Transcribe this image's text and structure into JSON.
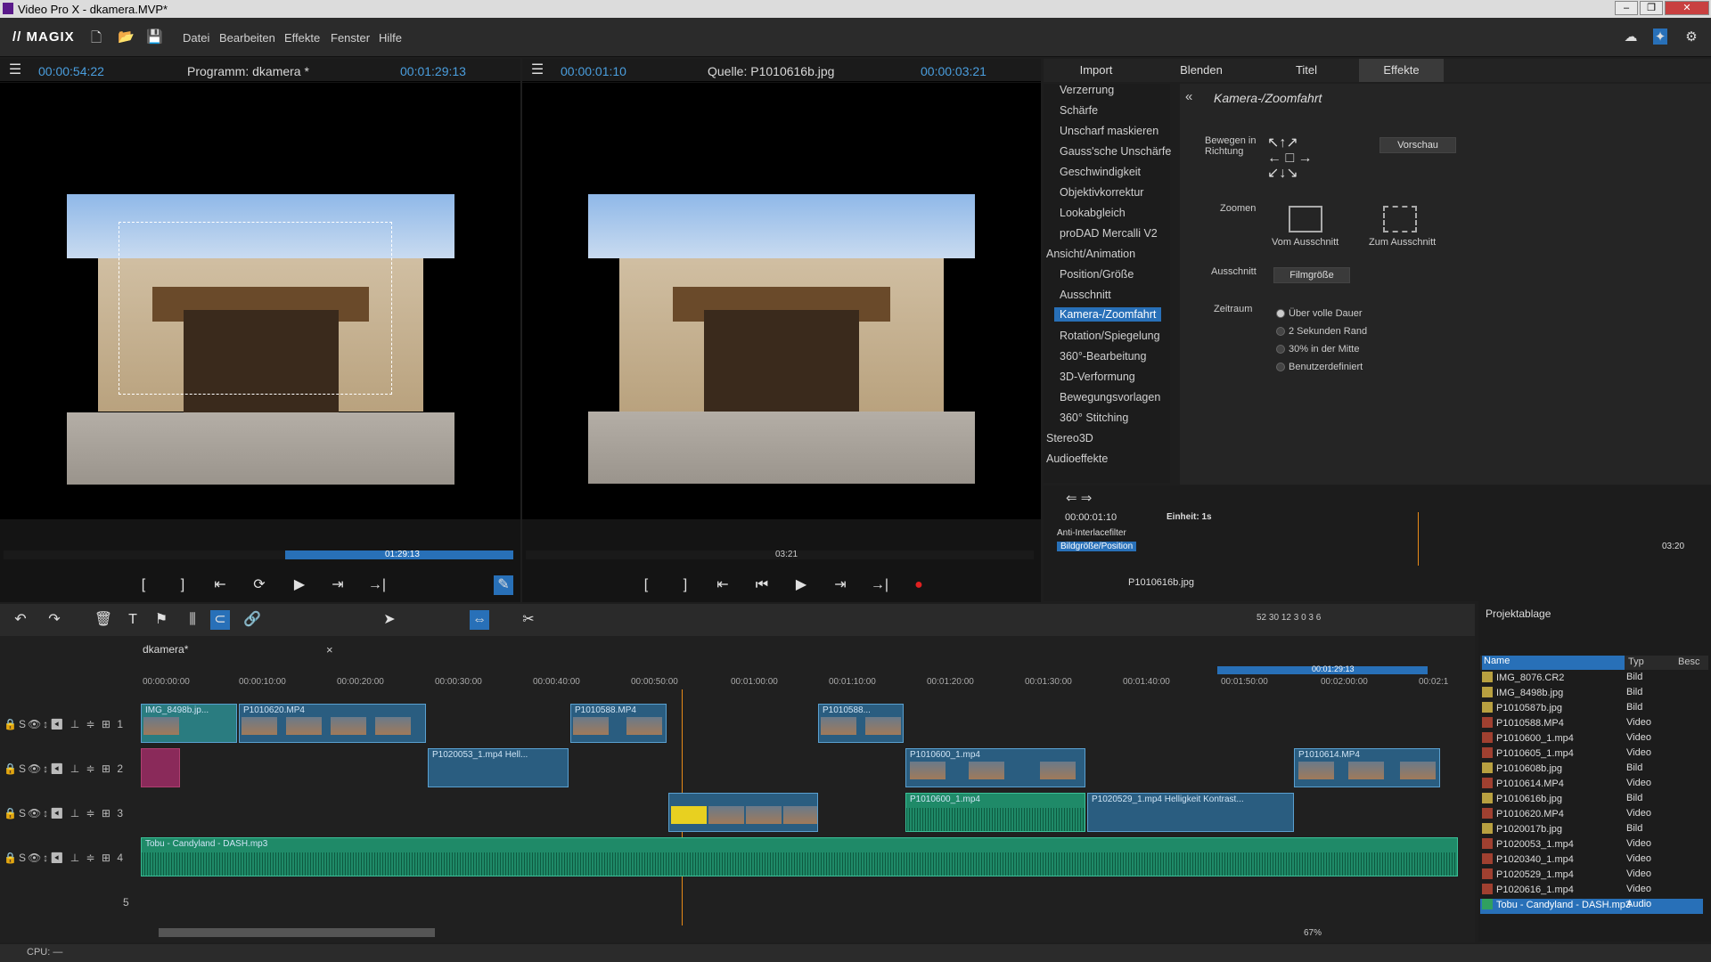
{
  "window": {
    "title": "Video Pro X - dkamera.MVP*"
  },
  "menubar": {
    "logo": "// MAGIX",
    "items": [
      "Datei",
      "Bearbeiten",
      "Effekte",
      "Fenster",
      "Hilfe"
    ]
  },
  "program_monitor": {
    "timecode_left": "00:00:54:22",
    "title": "Programm: dkamera *",
    "timecode_right": "00:01:29:13",
    "scrub_label": "01:29:13"
  },
  "source_monitor": {
    "timecode_left": "00:00:01:10",
    "title": "Quelle: P1010616b.jpg",
    "timecode_right": "00:00:03:21",
    "scrub_label": "03:21"
  },
  "tabs": [
    "Import",
    "Blenden",
    "Titel",
    "Effekte"
  ],
  "effects_list": [
    "Verzerrung",
    "Schärfe",
    "Unscharf maskieren",
    "Gauss'sche Unschärfe",
    "Geschwindigkeit",
    "Objektivkorrektur",
    "Lookabgleich",
    "proDAD Mercalli V2",
    "Ansicht/Animation",
    "Position/Größe",
    "Ausschnitt",
    "Kamera-/Zoomfahrt",
    "Rotation/Spiegelung",
    "360°-Bearbeitung",
    "3D-Verformung",
    "Bewegungsvorlagen",
    "360° Stitching",
    "Stereo3D",
    "Audioeffekte"
  ],
  "effect_panel": {
    "title": "Kamera-/Zoomfahrt",
    "move_label": "Bewegen in Richtung",
    "preview": "Vorschau",
    "zoom_label": "Zoomen",
    "zoom_from": "Vom Ausschnitt",
    "zoom_to": "Zum Ausschnitt",
    "crop_label": "Ausschnitt",
    "crop_btn": "Filmgröße",
    "range_label": "Zeitraum",
    "range_options": [
      "Über volle Dauer",
      "2 Sekunden Rand",
      "30% in der Mitte",
      "Benutzerdefiniert"
    ]
  },
  "keyframes": {
    "time": "00:00:01:10",
    "unit": "Einheit: 1s",
    "row1": "Anti-Interlacefilter",
    "row2": "Bildgröße/Position",
    "end": "03:20",
    "file": "P1010616b.jpg"
  },
  "timeline": {
    "tab": "dkamera*",
    "duration": "00:01:29:13",
    "ruler": [
      "00:00:00:00",
      "00:00:10:00",
      "00:00:20:00",
      "00:00:30:00",
      "00:00:40:00",
      "00:00:50:00",
      "00:01:00:00",
      "00:01:10:00",
      "00:01:20:00",
      "00:01:30:00",
      "00:01:40:00",
      "00:01:50:00",
      "00:02:00:00",
      "00:02:1"
    ],
    "clips": [
      "IMG_8498b.jp...",
      "P1010620.MP4",
      "P1010588.MP4",
      "P1010588...",
      "P1020053_1.mp4  Hell...",
      "P1010600_1.mp4",
      "P1010614.MP4",
      "P1010600_1.mp4",
      "P1020529_1.mp4  Helligkeit  Kontrast...",
      "Tobu - Candyland - DASH.mp3"
    ],
    "zoom": "67%",
    "meter": [
      "52",
      "30",
      "12",
      "3",
      "0",
      "3",
      "6"
    ],
    "track_labels": [
      "S",
      "1",
      "2",
      "3",
      "4",
      "5"
    ]
  },
  "project_bin": {
    "title": "Projektablage",
    "col_name": "Name",
    "col_type": "Typ",
    "col_desc": "Besc",
    "rows": [
      [
        "IMG_8076.CR2",
        "Bild"
      ],
      [
        "IMG_8498b.jpg",
        "Bild"
      ],
      [
        "P1010587b.jpg",
        "Bild"
      ],
      [
        "P1010588.MP4",
        "Video"
      ],
      [
        "P1010600_1.mp4",
        "Video"
      ],
      [
        "P1010605_1.mp4",
        "Video"
      ],
      [
        "P1010608b.jpg",
        "Bild"
      ],
      [
        "P1010614.MP4",
        "Video"
      ],
      [
        "P1010616b.jpg",
        "Bild"
      ],
      [
        "P1010620.MP4",
        "Video"
      ],
      [
        "P1020017b.jpg",
        "Bild"
      ],
      [
        "P1020053_1.mp4",
        "Video"
      ],
      [
        "P1020340_1.mp4",
        "Video"
      ],
      [
        "P1020529_1.mp4",
        "Video"
      ],
      [
        "P1020616_1.mp4",
        "Video"
      ],
      [
        "Tobu - Candyland - DASH.mp3",
        "Audio"
      ]
    ]
  },
  "status": {
    "cpu": "CPU: —"
  }
}
